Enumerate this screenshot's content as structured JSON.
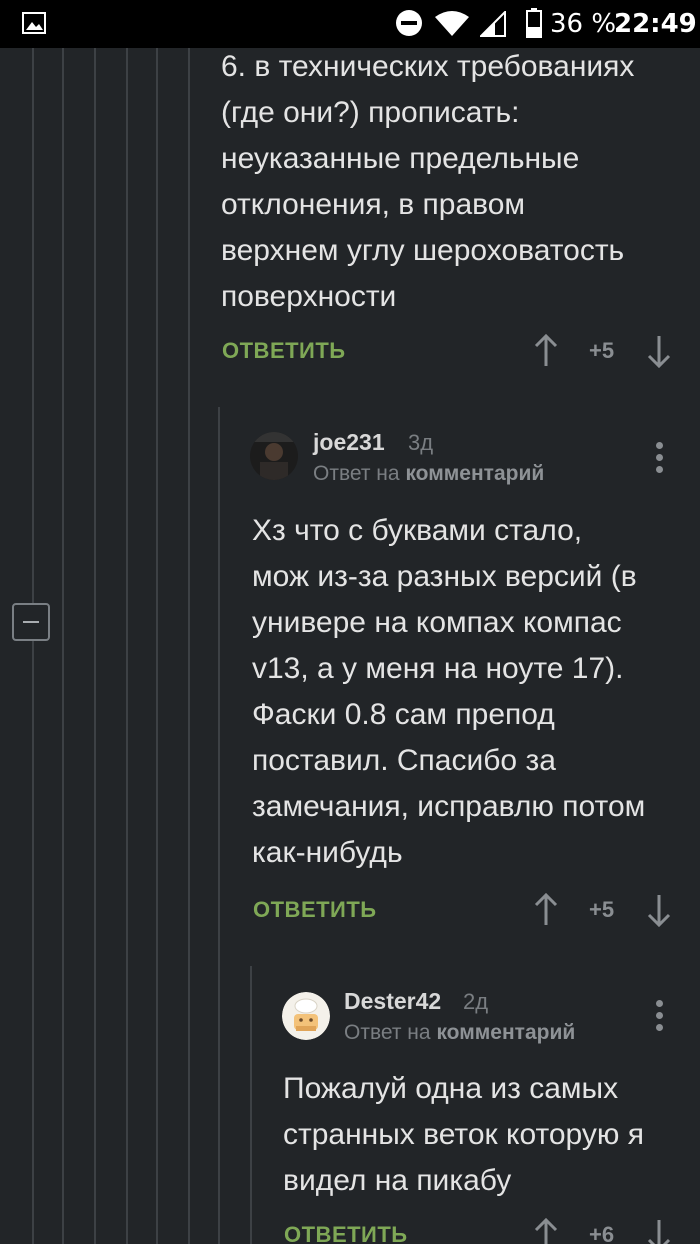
{
  "status_bar": {
    "battery_percent": "36 %",
    "time": "22:49"
  },
  "comments": [
    {
      "text_lines": [
        "6. в технических требованиях",
        "(где они?) прописать:",
        "неуказанные предельные",
        "отклонения, в правом",
        "верхнем углу шероховатость",
        "поверхности"
      ],
      "reply_label": "ОТВЕТИТЬ",
      "score": "+5"
    },
    {
      "author": "joe231",
      "age": "3д",
      "reply_prefix": "Ответ на",
      "reply_target": "комментарий",
      "text_lines": [
        "Хз что с буквами стало,",
        "мож из-за разных версий (в",
        "универе на компах компас",
        "v13, а у меня на ноуте 17).",
        "Фаски 0.8 сам препод",
        "поставил. Спасибо за",
        "замечания, исправлю потом",
        "как-нибудь"
      ],
      "reply_label": "ОТВЕТИТЬ",
      "score": "+5"
    },
    {
      "author": "Dester42",
      "age": "2д",
      "reply_prefix": "Ответ на",
      "reply_target": "комментарий",
      "text_lines": [
        "Пожалуй одна из самых",
        "странных веток которую я",
        "видел на пикабу"
      ],
      "reply_label": "ОТВЕТИТЬ",
      "score": "+6"
    }
  ],
  "icons": {
    "status_image": "image-icon",
    "dnd": "do-not-disturb-icon",
    "wifi": "wifi-icon",
    "signal": "signal-icon",
    "battery": "battery-icon",
    "upvote": "arrow-up-icon",
    "downvote": "arrow-down-icon",
    "more": "more-vertical-icon",
    "collapse": "minus-icon"
  },
  "colors": {
    "background": "#222528",
    "reply_accent": "#7fa856",
    "thread_line": "#3d4145"
  }
}
